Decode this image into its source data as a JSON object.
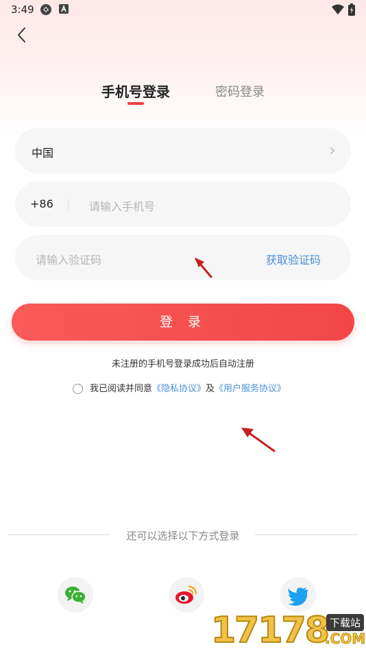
{
  "status_bar": {
    "time": "3:49"
  },
  "tabs": [
    {
      "label": "手机号登录",
      "active": true
    },
    {
      "label": "密码登录",
      "active": false
    }
  ],
  "form": {
    "country": "中国",
    "country_code": "+86",
    "phone_placeholder": "请输入手机号",
    "code_placeholder": "请输入验证码",
    "get_code_label": "获取验证码"
  },
  "login_button": "登 录",
  "notice": "未注册的手机号登录成功后自动注册",
  "agreement": {
    "prefix": "我已阅读并同意",
    "privacy_link": "《隐私协议》",
    "connector": "及",
    "service_link": "《用户服务协议》"
  },
  "other_login": {
    "label": "还可以选择以下方式登录",
    "methods": [
      {
        "name": "wechat",
        "icon": "wechat-icon",
        "color": "#3cb034"
      },
      {
        "name": "weibo",
        "icon": "weibo-icon",
        "color": "#e6162d"
      },
      {
        "name": "twitter",
        "icon": "twitter-icon",
        "color": "#1da1f2"
      }
    ]
  },
  "watermark": {
    "site": "17178",
    "tag": "下载站",
    "domain": ".COM"
  },
  "colors": {
    "accent": "#f24646",
    "link": "#4a90d9"
  }
}
